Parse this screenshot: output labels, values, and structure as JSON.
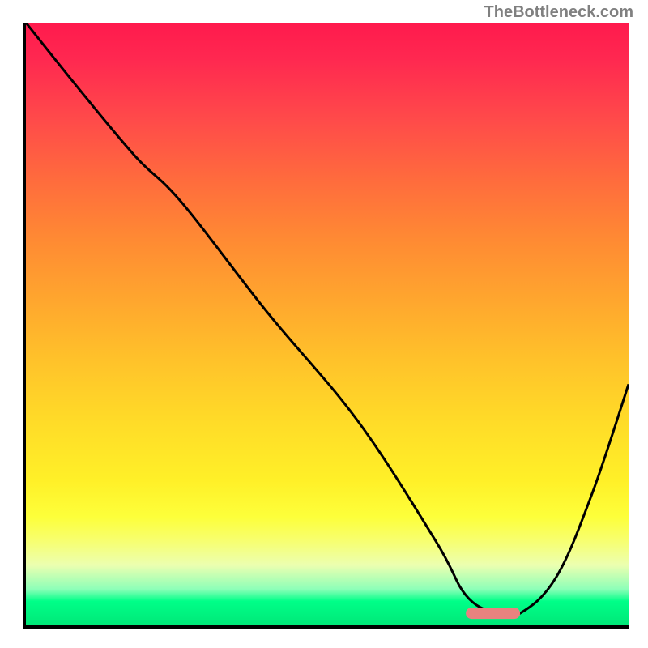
{
  "watermark": "TheBottleneck.com",
  "chart_data": {
    "type": "line",
    "title": "",
    "xlabel": "",
    "ylabel": "",
    "x_range": [
      0,
      100
    ],
    "y_range": [
      0,
      100
    ],
    "gradient_stops": [
      {
        "pos": 0,
        "color": "#ff1a4d"
      },
      {
        "pos": 16,
        "color": "#ff4a4a"
      },
      {
        "pos": 36,
        "color": "#ff8a33"
      },
      {
        "pos": 56,
        "color": "#ffc22a"
      },
      {
        "pos": 76,
        "color": "#fff028"
      },
      {
        "pos": 90,
        "color": "#ecffb0"
      },
      {
        "pos": 96,
        "color": "#00ff88"
      },
      {
        "pos": 100,
        "color": "#00e878"
      }
    ],
    "series": [
      {
        "name": "bottleneck-curve",
        "color": "#000000",
        "x": [
          0,
          8,
          18,
          26,
          40,
          55,
          68,
          73,
          78,
          82,
          88,
          94,
          100
        ],
        "y": [
          100,
          90,
          78,
          70,
          52,
          34,
          14,
          5,
          2,
          2,
          8,
          22,
          40
        ]
      }
    ],
    "marker": {
      "x_start": 73,
      "x_end": 82,
      "y": 2,
      "color": "#e8827f"
    }
  }
}
